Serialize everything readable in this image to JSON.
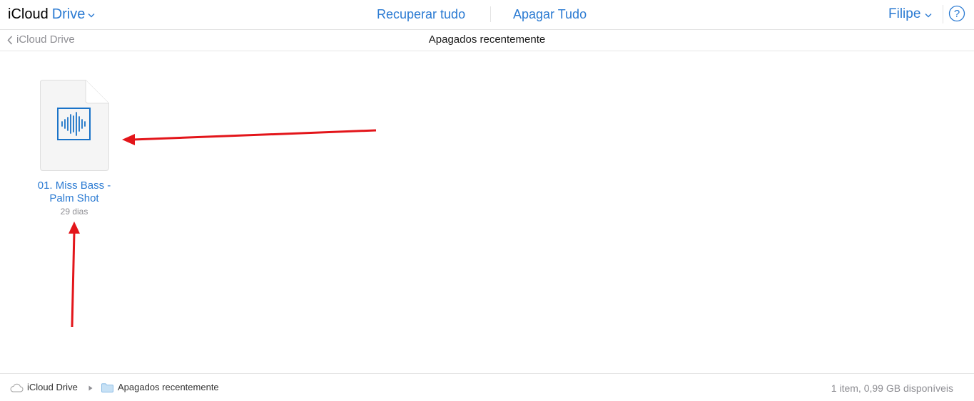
{
  "header": {
    "brand": "iCloud",
    "product": "Drive",
    "recover_label": "Recuperar tudo",
    "delete_label": "Apagar Tudo",
    "user_name": "Filipe",
    "help_icon": "question-circle-icon",
    "accent_color": "#2a7ad2"
  },
  "nav": {
    "back_label": "iCloud Drive",
    "title": "Apagados recentemente"
  },
  "files": [
    {
      "name": "01. Miss Bass -\nPalm Shot",
      "age": "29 dias",
      "icon": "audio-file-icon"
    }
  ],
  "annotations": {
    "color": "#e3151a"
  },
  "footer": {
    "crumbs": [
      "iCloud Drive",
      "Apagados recentemente"
    ],
    "storage": "1 item, 0,99 GB disponíveis"
  }
}
